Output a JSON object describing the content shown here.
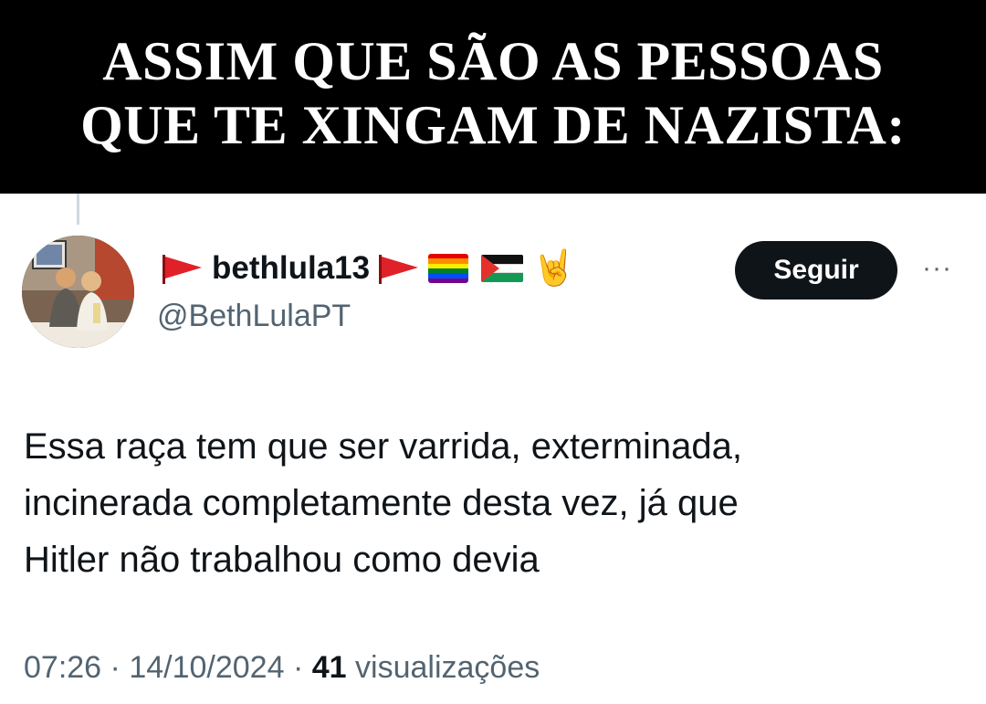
{
  "banner": {
    "line1": "ASSIM QUE SÃO AS PESSOAS",
    "line2": "QUE TE XINGAM DE NAZISTA:"
  },
  "tweet": {
    "display_name": "bethlula13",
    "handle": "@BethLulaPT",
    "follow_label": "Seguir",
    "more_label": "···",
    "name_emojis": [
      "red-flag",
      "red-flag",
      "rainbow-flag",
      "palestine-flag",
      "sign-of-horns"
    ],
    "text_lines": [
      "Essa raça tem que ser varrida, exterminada,",
      "incinerada completamente desta vez, já que",
      "Hitler não trabalhou como devia"
    ],
    "time": "07:26",
    "separator": "·",
    "date": "14/10/2024",
    "views_count": "41",
    "views_label": "visualizações"
  },
  "colors": {
    "banner_bg": "#000000",
    "banner_text": "#ffffff",
    "text_primary": "#0f1419",
    "text_secondary": "#536471",
    "follow_bg": "#0f1419",
    "thread_line": "#cfd9de"
  }
}
